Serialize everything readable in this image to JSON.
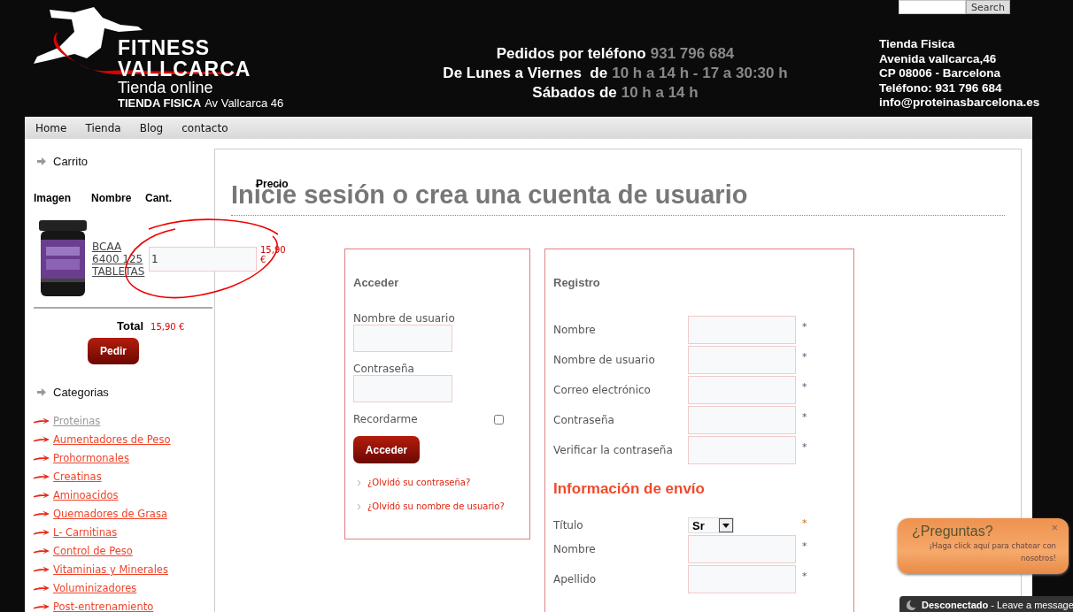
{
  "search": {
    "button": "Search"
  },
  "logo": {
    "line_1": "FITNESS",
    "line_2": "VALLCARCA",
    "tagline": "Tienda online",
    "store_label": "TIENDA FISICA",
    "store_address": "Av Vallcarca 46"
  },
  "contact_lines": [
    {
      "label": "Pedidos por teléfono",
      "value": "931 796 684"
    },
    {
      "label": "De Lunes a Viernes  de",
      "value": "10 h a 14 h - 17 a 30:30 h"
    },
    {
      "label": "Sábados de",
      "value": "10 h a 14 h"
    }
  ],
  "store_info": [
    "Tienda Fisica",
    "Avenida vallcarca,46",
    "CP 08006 - Barcelona",
    "Teléfono: 931 796 684",
    "info@proteinasbarcelona.es"
  ],
  "nav": [
    "Home",
    "Tienda",
    "Blog",
    "contacto"
  ],
  "cart": {
    "title": "Carrito",
    "columns": [
      "Imagen",
      "Nombre",
      "Cant.",
      "Precio"
    ],
    "item": {
      "name": "BCAA 6400 125 TABLETAS",
      "quantity": "1",
      "price": "15,90",
      "currency": "€"
    },
    "total_label": "Total",
    "total": "15,90 €",
    "order_button": "Pedir"
  },
  "categories": {
    "title": "Categorias",
    "items": [
      {
        "label": "Proteinas",
        "visited": true
      },
      {
        "label": "Aumentadores de Peso",
        "visited": false
      },
      {
        "label": "Prohormonales",
        "visited": false
      },
      {
        "label": "Creatinas",
        "visited": false
      },
      {
        "label": "Aminoacidos",
        "visited": false
      },
      {
        "label": "Quemadores de Grasa",
        "visited": false
      },
      {
        "label": "L- Carnitinas",
        "visited": false
      },
      {
        "label": "Control de Peso",
        "visited": false
      },
      {
        "label": "Vitaminias y Minerales",
        "visited": false
      },
      {
        "label": "Voluminizadores",
        "visited": false
      },
      {
        "label": "Post-entrenamiento",
        "visited": false
      }
    ]
  },
  "page_title": "Inicie sesión o crea una cuenta de usuario",
  "login": {
    "title": "Acceder",
    "fields": [
      {
        "label": "Nombre de usuario"
      },
      {
        "label": "Contraseña"
      }
    ],
    "remember": {
      "label": "Recordarme",
      "checked": false
    },
    "button": "Acceder",
    "links": [
      "¿Olvidó su contraseña?",
      "¿Olvidó su nombre de usuario?"
    ]
  },
  "register": {
    "title": "Registro",
    "fields": [
      {
        "label": "Nombre",
        "required": "*"
      },
      {
        "label": "Nombre de usuario",
        "required": "*"
      },
      {
        "label": "Correo electrónico",
        "required": "*"
      },
      {
        "label": "Contraseña",
        "required": "*"
      },
      {
        "label": "Verificar la contraseña",
        "required": "*"
      }
    ],
    "shipping_title": "Información de envío",
    "shipping_fields": [
      {
        "kind": "select",
        "label": "Título",
        "value": "Sr",
        "required": "*"
      },
      {
        "kind": "text",
        "label": "Nombre",
        "required": "*"
      },
      {
        "kind": "text",
        "label": "Apellido",
        "required": "*"
      }
    ]
  },
  "chat": {
    "title": "¿Preguntas?",
    "close": "×",
    "message": "¡Haga click aquí para chatear con nosotros!",
    "status": "**Desconectado** - Leave a message"
  }
}
